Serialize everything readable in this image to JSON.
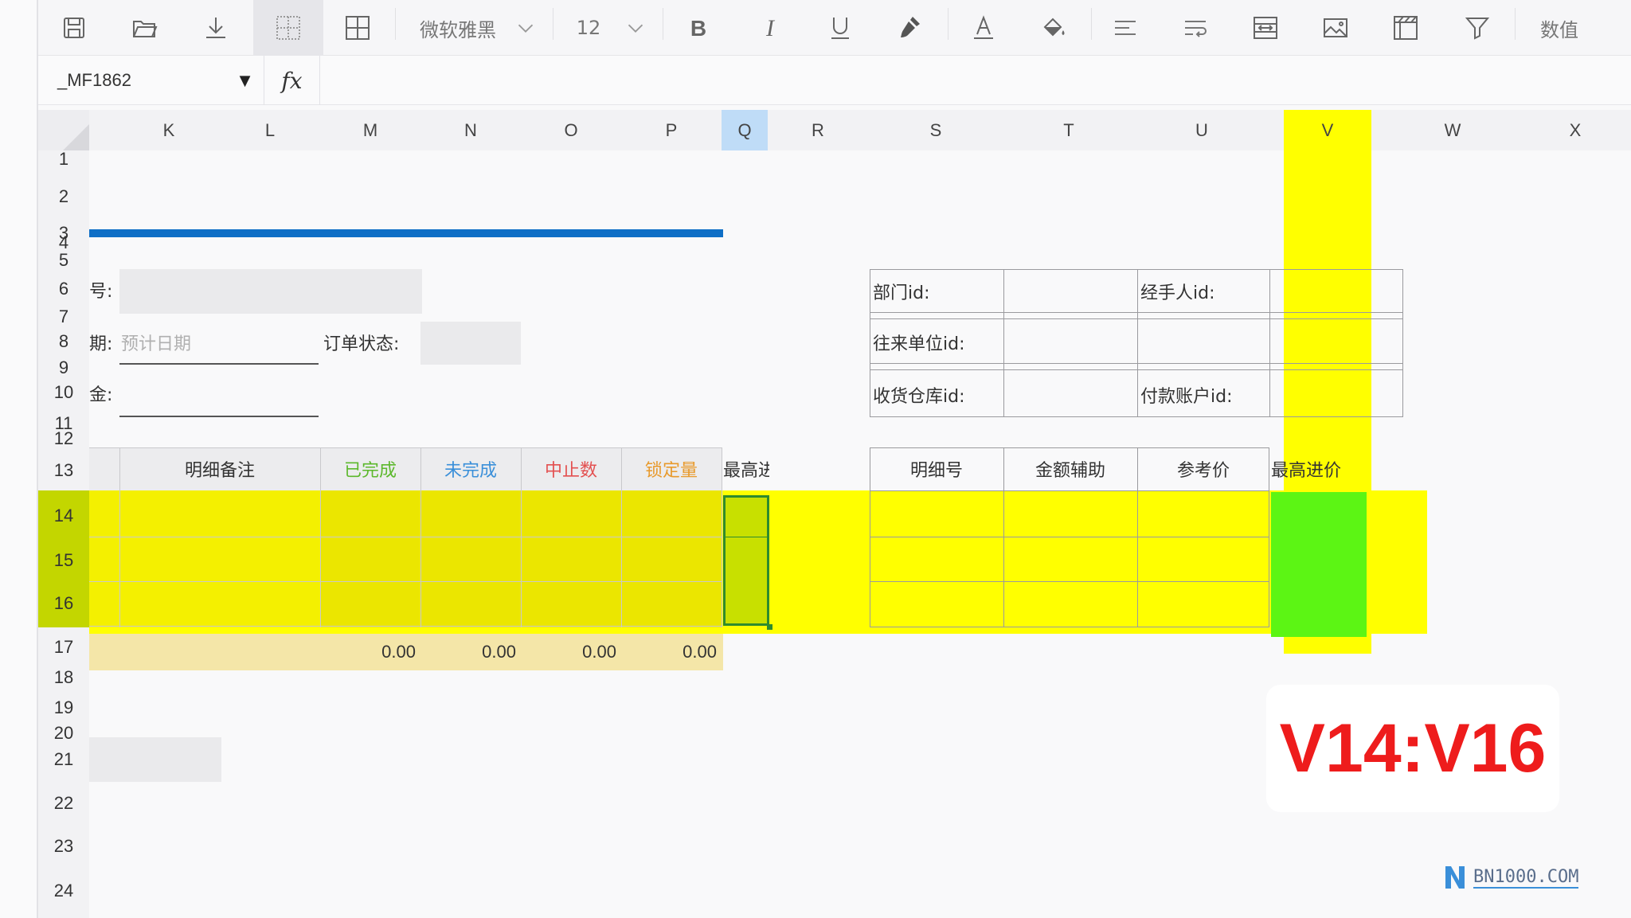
{
  "toolbar": {
    "font_name": "微软雅黑",
    "font_size": "12",
    "number_format": "数值",
    "icons": [
      "save-icon",
      "open-folder-icon",
      "download-icon",
      "border-none-icon",
      "border-all-icon",
      "bold-icon",
      "italic-icon",
      "underline-icon",
      "format-painter-icon",
      "font-color-icon",
      "fill-color-icon",
      "align-left-icon",
      "wrap-text-icon",
      "merge-cells-icon",
      "insert-image-icon",
      "freeze-icon",
      "filter-icon"
    ]
  },
  "formula_bar": {
    "name_box": "_MF1862",
    "fx_label": "fx",
    "formula": ""
  },
  "columns": [
    "K",
    "L",
    "M",
    "N",
    "O",
    "P",
    "Q",
    "R",
    "S",
    "T",
    "U",
    "V",
    "W",
    "X"
  ],
  "rows": [
    "1",
    "2",
    "3",
    "4",
    "5",
    "6",
    "7",
    "8",
    "9",
    "10",
    "11",
    "12",
    "13",
    "14",
    "15",
    "16",
    "17",
    "18",
    "19",
    "20",
    "21",
    "22",
    "23",
    "24"
  ],
  "form": {
    "row6_label_fragment": "号:",
    "row8_label_fragment": "期:",
    "row8_date_placeholder": "预计日期",
    "row8_status_label": "订单状态:",
    "row10_label_fragment": "金:"
  },
  "detail_table": {
    "headers": [
      "明细备注",
      "已完成",
      "未完成",
      "中止数",
      "锁定量",
      "最高进"
    ],
    "header_colors": {
      "已完成": "#5cb82c",
      "未完成": "#3a8fd9",
      "中止数": "#e35050",
      "锁定量": "#e89a2c"
    },
    "totals": [
      "0.00",
      "0.00",
      "0.00",
      "0.00"
    ]
  },
  "info_table": {
    "labels": [
      "部门id:",
      "经手人id:",
      "往来单位id:",
      "收货仓库id:",
      "付款账户id:"
    ]
  },
  "aux_table": {
    "headers": [
      "明细号",
      "金额辅助",
      "参考价",
      "最高进价"
    ]
  },
  "overlay": {
    "selection_range": "V14:V16",
    "watermark": "BN1000.COM"
  },
  "colors": {
    "highlight_yellow": "#ffff00",
    "selection_green": "#5cf514",
    "accent_blue": "#0f6fc6",
    "overlay_red": "#ee1c1c"
  }
}
